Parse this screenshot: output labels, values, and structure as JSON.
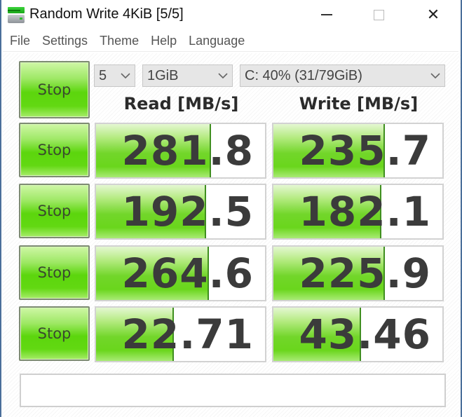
{
  "window": {
    "title": "Random Write 4KiB [5/5]",
    "icon": "drive-benchmark-icon",
    "controls": {
      "minimize": "minimize-icon",
      "maximize": "maximize-icon",
      "close": "close-icon",
      "close_glyph": "✕"
    }
  },
  "menu": [
    "File",
    "Settings",
    "Theme",
    "Help",
    "Language"
  ],
  "controls": {
    "all_button_label": "Stop",
    "count_select": "5",
    "size_select": "1GiB",
    "drive_select": "C: 40% (31/79GiB)"
  },
  "headers": {
    "read": "Read [MB/s]",
    "write": "Write [MB/s]"
  },
  "rows": [
    {
      "button_label": "Stop",
      "read": "281.8",
      "read_fill": 0.68,
      "write": "235.7",
      "write_fill": 0.66
    },
    {
      "button_label": "Stop",
      "read": "192.5",
      "read_fill": 0.65,
      "write": "182.1",
      "write_fill": 0.64
    },
    {
      "button_label": "Stop",
      "read": "264.6",
      "read_fill": 0.67,
      "write": "225.9",
      "write_fill": 0.66
    },
    {
      "button_label": "Stop",
      "read": "22.71",
      "read_fill": 0.46,
      "write": "43.46",
      "write_fill": 0.52
    }
  ],
  "comment": {
    "value": ""
  },
  "colors": {
    "accent_green": "#5cd60d",
    "fill_line": "#3f8f1f",
    "text_dark": "#3b3b3b"
  }
}
